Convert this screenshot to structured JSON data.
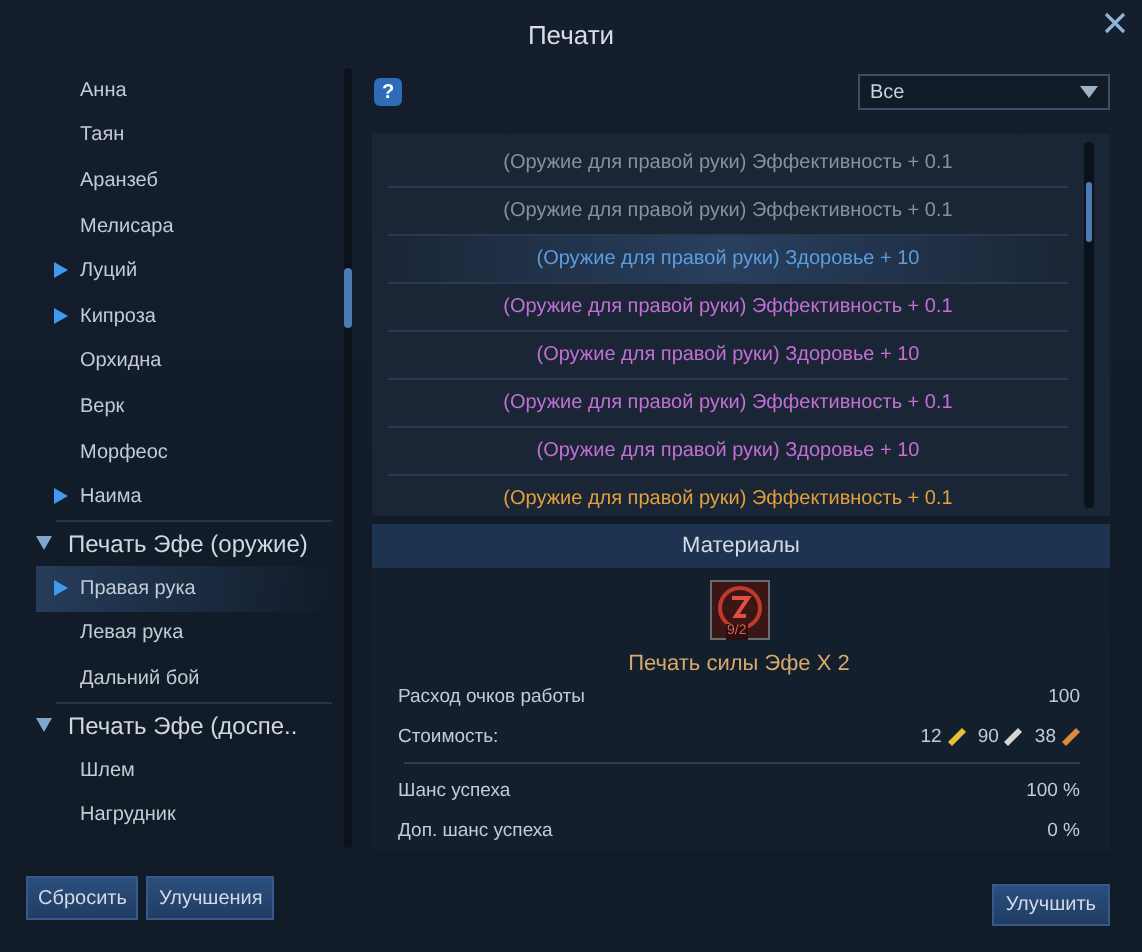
{
  "window": {
    "title": "Печати"
  },
  "tree": [
    {
      "children": [
        {
          "kind": "leaf",
          "label": "Анна",
          "selected": false
        },
        {
          "kind": "leaf",
          "label": "Таян",
          "selected": false
        },
        {
          "kind": "leaf",
          "label": "Аранзеб",
          "selected": false
        },
        {
          "kind": "leaf",
          "label": "Мелисара",
          "selected": false
        },
        {
          "kind": "group",
          "label": "Луций",
          "expanded": false,
          "selected": false
        },
        {
          "kind": "group",
          "label": "Кипроза",
          "expanded": false,
          "selected": false
        },
        {
          "kind": "leaf",
          "label": "Орхидна",
          "selected": false
        },
        {
          "kind": "leaf",
          "label": "Верк",
          "selected": false
        },
        {
          "kind": "leaf",
          "label": "Морфеос",
          "selected": false
        },
        {
          "kind": "group",
          "label": "Наима",
          "expanded": false,
          "selected": false
        }
      ]
    },
    {
      "label": "Печать Эфе (оружие)",
      "expanded": true,
      "children": [
        {
          "kind": "group",
          "label": "Правая рука",
          "expanded": false,
          "selected": true
        },
        {
          "kind": "leaf",
          "label": "Левая рука",
          "selected": false
        },
        {
          "kind": "leaf",
          "label": "Дальний бой",
          "selected": false
        }
      ]
    },
    {
      "label": "Печать Эфе (доспе..",
      "expanded": true,
      "children": [
        {
          "kind": "leaf",
          "label": "Шлем",
          "selected": false
        },
        {
          "kind": "leaf",
          "label": "Нагрудник",
          "selected": false
        }
      ]
    }
  ],
  "left_buttons": [
    "Сбросить",
    "Улучшения"
  ],
  "help_button": "?",
  "filter": {
    "value": "Все"
  },
  "effects": [
    {
      "text": "(Оружие для правой руки) Эффективность + 0.1",
      "color": "#8c9099",
      "selected": false
    },
    {
      "text": "(Оружие для правой руки) Эффективность + 0.1",
      "color": "#8c9099",
      "selected": false
    },
    {
      "text": "(Оружие для правой руки) Здоровье + 10",
      "color": "#5b9ee0",
      "selected": true
    },
    {
      "text": "(Оружие для правой руки) Эффективность + 0.1",
      "color": "#c46fd6",
      "selected": false
    },
    {
      "text": "(Оружие для правой руки) Здоровье + 10",
      "color": "#c46fd6",
      "selected": false
    },
    {
      "text": "(Оружие для правой руки) Эффективность + 0.1",
      "color": "#c46fd6",
      "selected": false
    },
    {
      "text": "(Оружие для правой руки) Здоровье + 10",
      "color": "#c46fd6",
      "selected": false
    },
    {
      "text": "(Оружие для правой руки) Эффективность + 0.1",
      "color": "#e3a03c",
      "selected": false
    }
  ],
  "materials": {
    "title": "Материалы",
    "item_badge": "9/2",
    "item_name": "Печать силы Эфе X 2",
    "rows": [
      {
        "label": "Расход очков работы",
        "value": "100"
      }
    ],
    "cost": {
      "label": "Стоимость:",
      "coins": [
        {
          "amount": "12",
          "color": "#e8c232"
        },
        {
          "amount": "90",
          "color": "#d6d6d6"
        },
        {
          "amount": "38",
          "color": "#e08a3a"
        }
      ]
    },
    "chance_rows": [
      {
        "label": "Шанс успеха",
        "value": "100 %"
      },
      {
        "label": "Доп. шанс успеха",
        "value": "0 %"
      }
    ]
  },
  "upgrade_button": "Улучшить"
}
